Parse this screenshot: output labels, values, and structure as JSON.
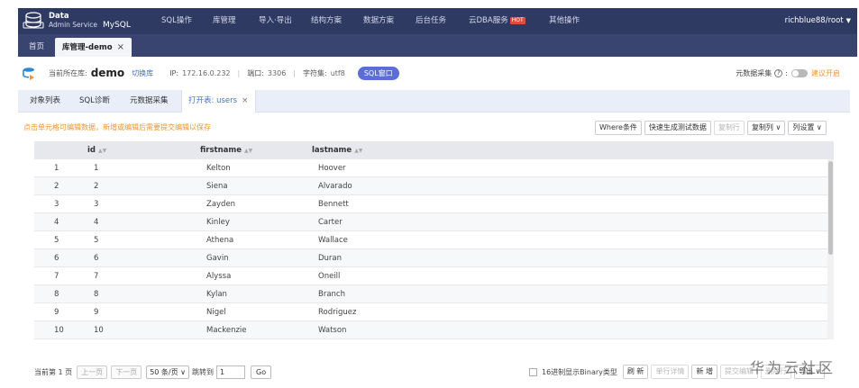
{
  "brand": {
    "line1": "Data",
    "line2": "Admin Service",
    "db": "MySQL"
  },
  "menu": [
    {
      "label": "SQL操作"
    },
    {
      "label": "库管理"
    },
    {
      "label": "导入·导出"
    },
    {
      "label": "结构方案"
    },
    {
      "label": "数据方案"
    },
    {
      "label": "后台任务"
    },
    {
      "label": "云DBA服务",
      "badge": "HOT"
    },
    {
      "label": "其他操作"
    }
  ],
  "user": "richblue88/root",
  "page_tabs": {
    "home": "首页",
    "active": "库管理-demo",
    "close": "×"
  },
  "info": {
    "current_db_label": "当前所在库:",
    "db_name": "demo",
    "switch_db": "切换库",
    "ip_label": "IP:",
    "ip": "172.16.0.232",
    "port_label": "端口:",
    "port": "3306",
    "charset_label": "字符集:",
    "charset": "utf8",
    "sql_window": "SQL窗口",
    "meta_label": "元数据采集",
    "meta_colon": ":",
    "suggest": "建议开启"
  },
  "sub_tabs": {
    "objects": "对象列表",
    "sql_diag": "SQL诊断",
    "meta_collect": "元数据采集",
    "open_table": "打开表: users",
    "close": "×"
  },
  "hint": "点击单元格可编辑数据，新增或编辑后需要提交编辑以保存",
  "toolbar": {
    "where": "Where条件",
    "gen_test": "快速生成测试数据",
    "copy_row": "复制行",
    "copy_col": "复制列 ∨",
    "col_settings": "列设置 ∨"
  },
  "table": {
    "columns": [
      "id",
      "firstname",
      "lastname"
    ],
    "rows": [
      {
        "n": "1",
        "id": "1",
        "firstname": "Kelton",
        "lastname": "Hoover"
      },
      {
        "n": "2",
        "id": "2",
        "firstname": "Siena",
        "lastname": "Alvarado"
      },
      {
        "n": "3",
        "id": "3",
        "firstname": "Zayden",
        "lastname": "Bennett"
      },
      {
        "n": "4",
        "id": "4",
        "firstname": "Kinley",
        "lastname": "Carter"
      },
      {
        "n": "5",
        "id": "5",
        "firstname": "Athena",
        "lastname": "Wallace"
      },
      {
        "n": "6",
        "id": "6",
        "firstname": "Gavin",
        "lastname": "Duran"
      },
      {
        "n": "7",
        "id": "7",
        "firstname": "Alyssa",
        "lastname": "Oneill"
      },
      {
        "n": "8",
        "id": "8",
        "firstname": "Kylan",
        "lastname": "Branch"
      },
      {
        "n": "9",
        "id": "9",
        "firstname": "Nigel",
        "lastname": "Rodriguez"
      },
      {
        "n": "10",
        "id": "10",
        "firstname": "Mackenzie",
        "lastname": "Watson"
      }
    ]
  },
  "footer": {
    "page_info": "当前第 1 页",
    "prev": "上一页",
    "next": "下一页",
    "page_size": "50 条/页 ∨",
    "jump_label": "跳转到",
    "jump_value": "1",
    "go": "Go",
    "binary_label": "16进制显示Binary类型",
    "refresh": "刷 新",
    "row_detail": "单行详情",
    "add": "新 增",
    "submit": "提交编辑",
    "delete_row": "删除行",
    "export": "导出 ∨"
  },
  "watermark": "华为云社区",
  "colors": {
    "nav": "#2f3a63",
    "accent": "#4a6fd8",
    "hint": "#f0952d",
    "hot": "#e8483b"
  }
}
